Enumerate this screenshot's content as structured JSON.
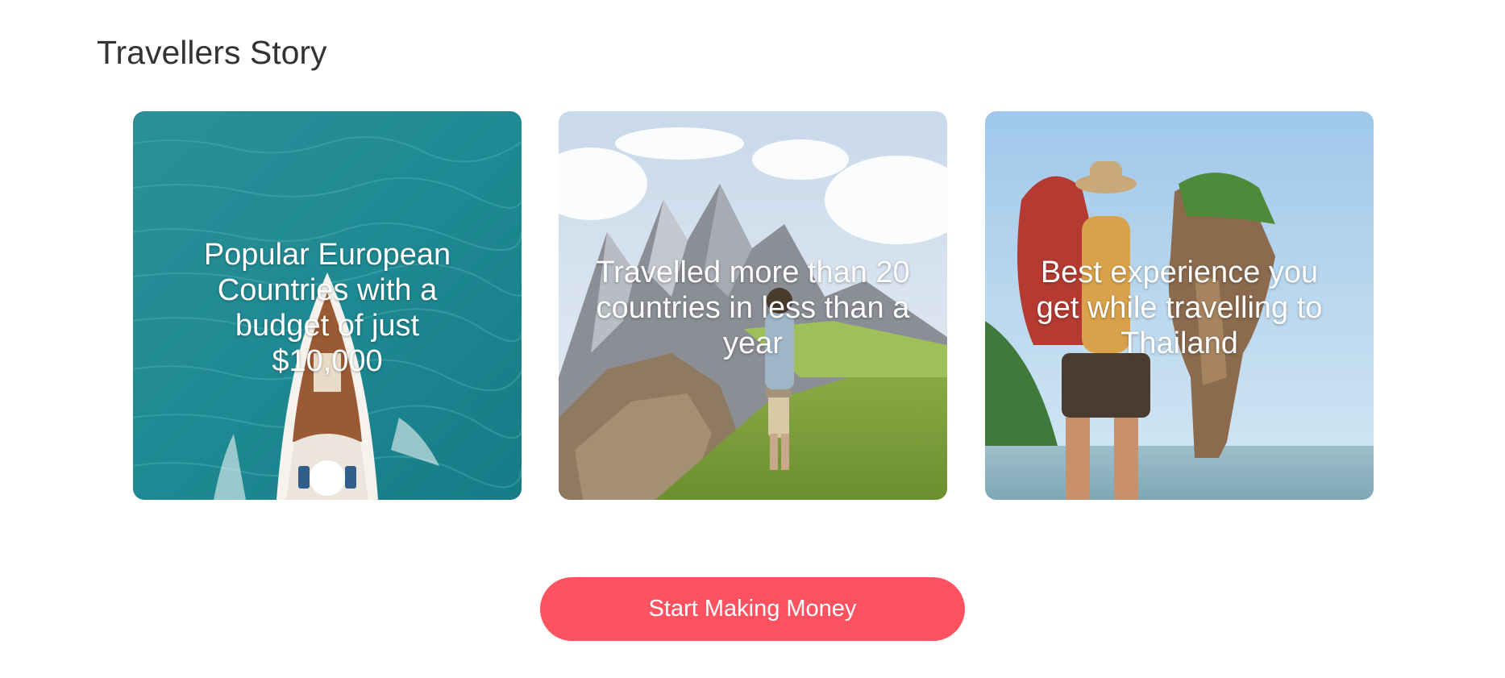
{
  "section": {
    "title": "Travellers Story"
  },
  "cards": [
    {
      "text": "Popular European Countries with a budget of just $10,000"
    },
    {
      "text": "Travelled more than 20 countries in less than a year"
    },
    {
      "text": "Best experience you get while travelling to Thailand"
    }
  ],
  "cta": {
    "label": "Start Making Money"
  },
  "colors": {
    "accent": "#ff5261",
    "title": "#333333",
    "card_text": "#ffffff"
  }
}
